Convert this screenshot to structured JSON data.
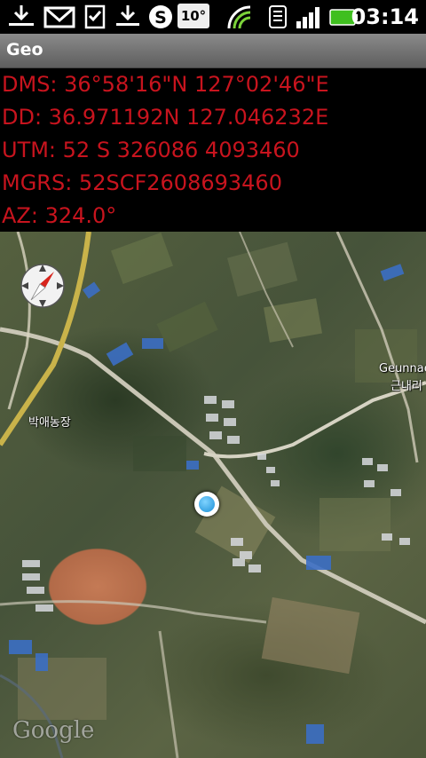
{
  "status_bar": {
    "time": "03:14",
    "notification_temp": "10°",
    "icons": [
      "download-icon",
      "gmail-icon",
      "clipboard-check-icon",
      "download-icon",
      "skype-icon",
      "weather-icon",
      "signal-arrows-icon",
      "wifi-icon",
      "cell-signal-icon",
      "battery-icon"
    ],
    "battery_color": "#3fbf1f"
  },
  "app": {
    "title": "Geo"
  },
  "coordinates": {
    "dms": "DMS: 36°58'16\"N 127°02'46\"E",
    "dd": "DD: 36.971192N 127.046232E",
    "utm": "UTM: 52 S 326086 4093460",
    "mgrs": "MGRS: 52SCF2608693460",
    "az": "AZ: 324.0°",
    "text_color": "#c8141e"
  },
  "map": {
    "labels": {
      "bakae_farm": "박애농장",
      "geunnae_en": "Geunnae-",
      "geunnae_ko": "근내리"
    },
    "attribution": "Google",
    "compass_icon": "compass-icon",
    "location_icon": "my-location-icon"
  }
}
